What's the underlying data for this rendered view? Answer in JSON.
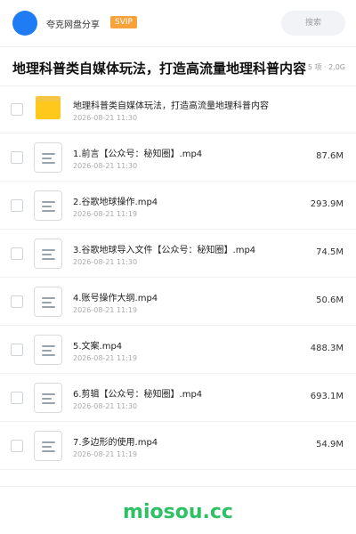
{
  "header": {
    "share_name": "夸克网盘分享",
    "vip_badge": "SVIP",
    "search_placeholder": "搜索"
  },
  "folder_title": "地理科普类自媒体玩法，打造高流量地理科普内容",
  "folder_meta": "5 项 · 2.0G",
  "items": [
    {
      "type": "folder",
      "name": "地理科普类自媒体玩法，打造高流量地理科普内容",
      "date": "2026-08-21 11:30",
      "size": ""
    },
    {
      "type": "file",
      "name": "1.前言【公众号：秘知圈】.mp4",
      "date": "2026-08-21 11:30",
      "size": "87.6M"
    },
    {
      "type": "file",
      "name": "2.谷歌地球操作.mp4",
      "date": "2026-08-21 11:19",
      "size": "293.9M"
    },
    {
      "type": "file",
      "name": "3.谷歌地球导入文件【公众号：秘知圈】.mp4",
      "date": "2026-08-21 11:30",
      "size": "74.5M"
    },
    {
      "type": "file",
      "name": "4.账号操作大纲.mp4",
      "date": "2026-08-21 11:19",
      "size": "50.6M"
    },
    {
      "type": "file",
      "name": "5.文案.mp4",
      "date": "2026-08-21 11:19",
      "size": "488.3M"
    },
    {
      "type": "file",
      "name": "6.剪辑【公众号：秘知圈】.mp4",
      "date": "2026-08-21 11:30",
      "size": "693.1M"
    },
    {
      "type": "file",
      "name": "7.多边形的使用.mp4",
      "date": "2026-08-21 11:19",
      "size": "54.9M"
    }
  ],
  "watermark": "miosou.cc",
  "colors": {
    "avatar": "#1f7cf5",
    "vip": "#f7a23a",
    "folder": "#ffc81a",
    "watermark": "#2ec065"
  },
  "icons": {
    "folder": "folder-icon",
    "file": "video-file-icon",
    "checkbox": "checkbox-icon"
  }
}
